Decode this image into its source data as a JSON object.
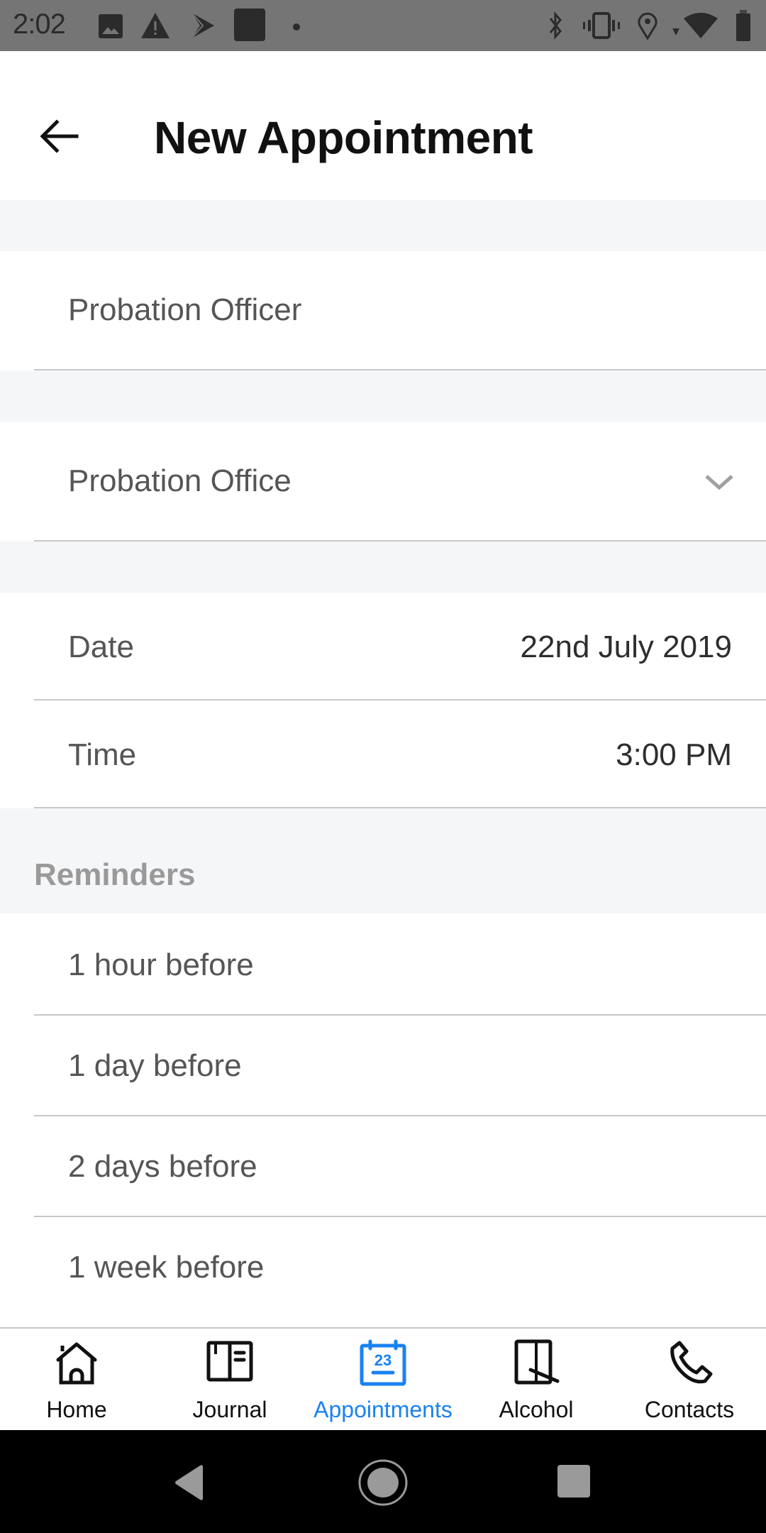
{
  "status_bar": {
    "time": "2:02",
    "left_icons": [
      "image-icon",
      "warning-icon",
      "play-store-icon",
      "app-square-icon",
      "dot-icon"
    ],
    "right_icons": [
      "bluetooth-icon",
      "vibrate-icon",
      "location-icon",
      "wifi-icon",
      "battery-icon"
    ]
  },
  "header": {
    "back_icon": "arrow-left-icon",
    "title": "New Appointment"
  },
  "form": {
    "officer": {
      "placeholder": "Probation Officer",
      "value": ""
    },
    "office": {
      "selected": "Probation Office",
      "icon": "chevron-down-icon"
    },
    "date": {
      "label": "Date",
      "value": "22nd July 2019"
    },
    "time": {
      "label": "Time",
      "value": "3:00 PM"
    }
  },
  "reminders": {
    "title": "Reminders",
    "items": [
      {
        "label": "1 hour before"
      },
      {
        "label": "1 day before"
      },
      {
        "label": "2 days before"
      },
      {
        "label": "1 week before"
      }
    ]
  },
  "tabs": [
    {
      "label": "Home",
      "icon": "home-icon",
      "active": false
    },
    {
      "label": "Journal",
      "icon": "journal-icon",
      "active": false
    },
    {
      "label": "Appointments",
      "icon": "calendar-icon",
      "active": true,
      "icon_text": "23"
    },
    {
      "label": "Alcohol",
      "icon": "alcohol-icon",
      "active": false
    },
    {
      "label": "Contacts",
      "icon": "phone-icon",
      "active": false
    }
  ],
  "colors": {
    "accent": "#1a82f0",
    "background": "#f5f6f8",
    "status_bar": "#757575"
  },
  "nav_bar": {
    "buttons": [
      "back-triangle-icon",
      "home-circle-icon",
      "recents-square-icon"
    ]
  }
}
